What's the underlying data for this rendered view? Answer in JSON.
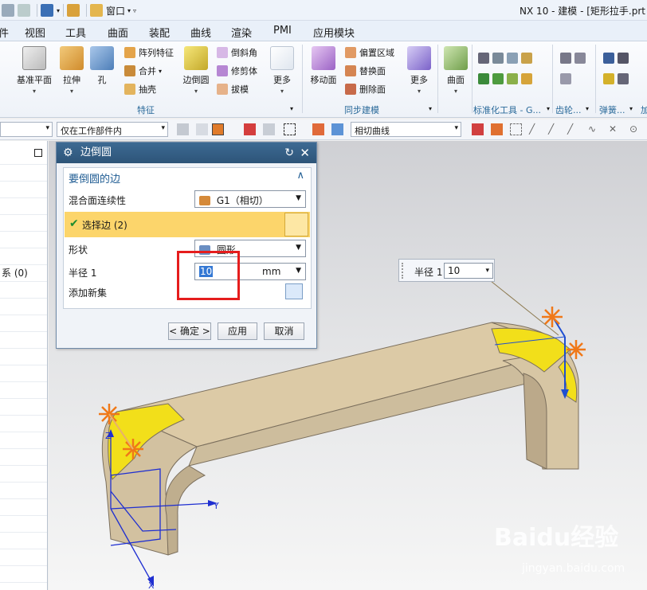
{
  "window": {
    "title": "NX 10 - 建模 - [矩形拉手.prt"
  },
  "quick_access": {
    "window_menu": "窗口"
  },
  "menu": {
    "tabs": [
      "件",
      "视图",
      "工具",
      "曲面",
      "装配",
      "曲线",
      "渲染",
      "PMI",
      "应用模块"
    ]
  },
  "ribbon": {
    "feature_group": {
      "label": "特征",
      "datum_plane": "基准平面",
      "extrude": "拉伸",
      "hole": "孔",
      "pattern_feature": "阵列特征",
      "unite": "合并",
      "shell": "抽壳",
      "edge_blend": "边倒圆",
      "chamfer": "倒斜角",
      "trim_body": "修剪体",
      "draft": "拔模",
      "more": "更多"
    },
    "sync_group": {
      "label": "同步建模",
      "move_face": "移动面",
      "offset_region": "偏置区域",
      "replace_face": "替换面",
      "delete_face": "删除面",
      "more": "更多"
    },
    "surface_group": {
      "surface": "曲面"
    },
    "std_tools_label": "标准化工具 - G...",
    "gear_label": "齿轮...",
    "spring_label": "弹簧...",
    "last_label": "加"
  },
  "selection_bar": {
    "scope": "仅在工作部件内",
    "curve_rule": "相切曲线"
  },
  "navigator": {
    "partial_row": "系 (0)"
  },
  "dialog": {
    "title": "边倒圆",
    "section": "要倒圆的边",
    "continuity_label": "混合面连续性",
    "continuity_value": "G1（相切）",
    "select_edge": "选择边 (2)",
    "shape_label": "形状",
    "shape_value": "圆形",
    "radius_label": "半径 1",
    "radius_value": "10",
    "radius_unit": "mm",
    "add_new_set": "添加新集",
    "ok": "< 确定 >",
    "apply": "应用",
    "cancel": "取消"
  },
  "onscreen_input": {
    "label": "半径 1",
    "value": "10"
  },
  "colors": {
    "dialog_title": "#2d5478",
    "selection_row": "#fcd56b",
    "highlight_box": "#e51d1d",
    "model_face": "#dccaa6",
    "blend_face": "#f2df1a"
  },
  "watermark": {
    "logo": "Baidu经验",
    "url": "jingyan.baidu.com"
  }
}
